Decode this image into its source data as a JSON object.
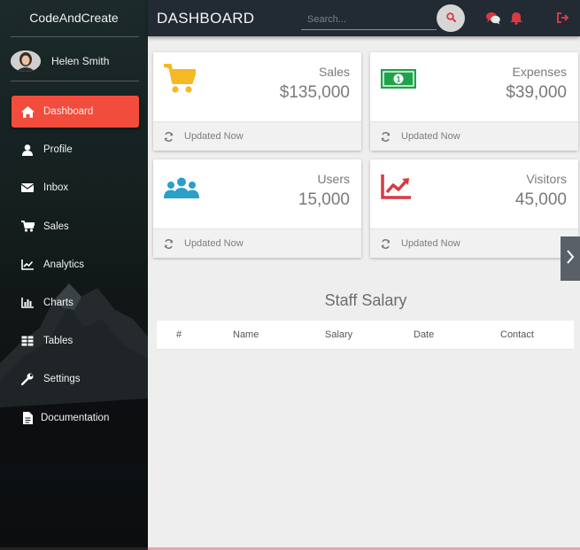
{
  "sidebar": {
    "brand": "CodeAndCreate",
    "user_name": "Helen Smith",
    "items": [
      {
        "label": "Dashboard",
        "icon": "home-icon"
      },
      {
        "label": "Profile",
        "icon": "user-icon"
      },
      {
        "label": "Inbox",
        "icon": "envelope-icon"
      },
      {
        "label": "Sales",
        "icon": "cart-icon"
      },
      {
        "label": "Analytics",
        "icon": "line-chart-icon"
      },
      {
        "label": "Charts",
        "icon": "bar-chart-icon"
      },
      {
        "label": "Tables",
        "icon": "table-icon"
      },
      {
        "label": "Settings",
        "icon": "wrench-icon"
      },
      {
        "label": "Documentation",
        "icon": "file-icon"
      }
    ]
  },
  "topbar": {
    "title": "DASHBOARD",
    "search_placeholder": "Search..."
  },
  "cards": [
    {
      "label": "Sales",
      "value": "$135,000",
      "footer": "Updated Now",
      "icon": "cart-icon",
      "color": "#f5b926"
    },
    {
      "label": "Expenses",
      "value": "$39,000",
      "footer": "Updated Now",
      "icon": "money-icon",
      "color": "#1fa34a"
    },
    {
      "label": "Users",
      "value": "15,000",
      "footer": "Updated Now",
      "icon": "users-icon",
      "color": "#2a9fc9"
    },
    {
      "label": "Visitors",
      "value": "45,000",
      "footer": "Updated Now",
      "icon": "line-chart-icon",
      "color": "#d63b42"
    }
  ],
  "salary": {
    "title": "Staff Salary",
    "columns": [
      "#",
      "Name",
      "Salary",
      "Date",
      "Contact"
    ]
  },
  "colors": {
    "accent": "#f24c3d",
    "topbar": "#222a33"
  }
}
